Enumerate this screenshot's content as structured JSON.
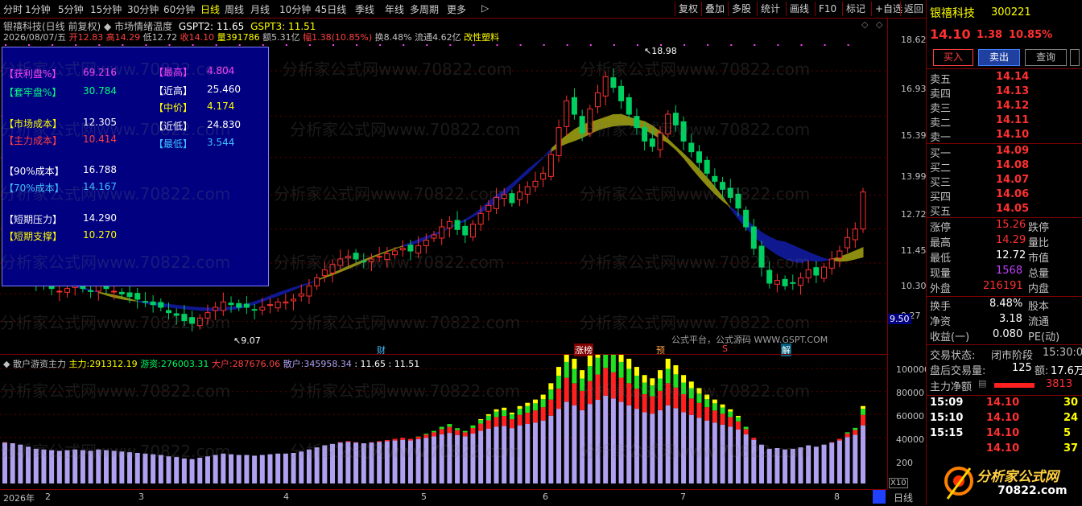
{
  "toolbar": {
    "periods": [
      "分时",
      "1分钟",
      "5分钟",
      "15分钟",
      "30分钟",
      "60分钟",
      "日线",
      "周线",
      "月线",
      "10分钟",
      "45日线",
      "季线",
      "年线",
      "多周期",
      "更多"
    ],
    "active_period": "日线",
    "more_arrow": "▷",
    "right_buttons": [
      "复权",
      "叠加",
      "多股",
      "统计",
      "画线",
      "F10",
      "标记",
      "+自选",
      "返回"
    ]
  },
  "chart_title": {
    "stock": "银禧科技(日线 前复权)",
    "indicator": "市场情绪温度",
    "gspt2": "GSPT2: 11.65",
    "gspt3": "GSPT3: 11.51"
  },
  "bar_info": {
    "date": "2026/08/07/五",
    "open_label": "开",
    "open": "12.83",
    "high_label": "高",
    "high": "14.29",
    "low_label": "低",
    "low": "12.72",
    "close_label": "收",
    "close": "14.10",
    "volume_label": "量",
    "volume": "391786",
    "amount_label": "额",
    "amount": "5.31亿",
    "change_label": "幅",
    "change": "1.38(10.85%)",
    "turnover_label": "换",
    "turnover": "8.48%",
    "float_label": "流通",
    "float": "4.62亿",
    "sector": "改性塑料"
  },
  "stats": {
    "profit_label": "【获利盘%】",
    "profit": "69.216",
    "trapped_label": "【套牢盘%】",
    "trapped": "30.784",
    "market_cost_label": "【市场成本】",
    "market_cost": "12.305",
    "main_cost_label": "【主力成本】",
    "main_cost": "10.414",
    "cost90_label": "【90%成本】",
    "cost90": "16.788",
    "cost70_label": "【70%成本】",
    "cost70": "14.167",
    "pressure_label": "【短期压力】",
    "pressure": "14.290",
    "support_label": "【短期支撑】",
    "support": "10.270",
    "highest_label": "【最高】",
    "highest": "4.804",
    "recent_high_label": "【近高】",
    "recent_high": "25.460",
    "mid_label": "【中价】",
    "mid": "4.174",
    "recent_low_label": "【近低】",
    "recent_low": "24.830",
    "lowest_label": "【最低】",
    "lowest": "3.544"
  },
  "price_axis": [
    "18.62",
    "16.93",
    "15.39",
    "13.99",
    "12.72",
    "11.45",
    "10.30",
    "9.27"
  ],
  "price_tag": "9.50",
  "chart_labels": {
    "high_mark": "18.98",
    "low_mark": "9.07",
    "event_cai": "财",
    "event_zhangbang": "涨榜",
    "event_yu": "预",
    "event_s": "S",
    "event_jie": "解",
    "platform_text": "公式平台，公式源码 WWW.GSPT.COM"
  },
  "watermark": "分析家公式网www.70822.com",
  "sub_chart": {
    "name": "散户游资主力",
    "main_label": "主力:",
    "main_value": "291312.19",
    "hot_label": "游资:",
    "hot_value": "276003.31",
    "big_label": "大户:",
    "big_value": "287676.06",
    "retail_label": "散户:",
    "retail_value": "345958.34",
    "v1": ": 11.65",
    "v2": ": 11.51"
  },
  "vol_axis": [
    "100000",
    "80000",
    "60000",
    "40000",
    "200"
  ],
  "vol_unit": "X10",
  "date_axis": [
    "2026年",
    "2",
    "3",
    "4",
    "5",
    "6",
    "7",
    "8"
  ],
  "date_tab": "日线",
  "quote": {
    "name": "银禧科技",
    "code": "300221",
    "price": "14.10",
    "change": "1.38",
    "change_pct": "10.85%",
    "buy_btn": "买入",
    "sell_btn": "卖出",
    "query_btn": "查询",
    "asks": [
      {
        "label": "卖五",
        "price": "14.14"
      },
      {
        "label": "卖四",
        "price": "14.13"
      },
      {
        "label": "卖三",
        "price": "14.12"
      },
      {
        "label": "卖二",
        "price": "14.11"
      },
      {
        "label": "卖一",
        "price": "14.10"
      }
    ],
    "bids": [
      {
        "label": "买一",
        "price": "14.09"
      },
      {
        "label": "买二",
        "price": "14.08"
      },
      {
        "label": "买三",
        "price": "14.07"
      },
      {
        "label": "买四",
        "price": "14.06"
      },
      {
        "label": "买五",
        "price": "14.05"
      }
    ],
    "limit_up_label": "涨停",
    "limit_up": "15.26",
    "limit_down_label": "跌停",
    "high_label": "最高",
    "high": "14.29",
    "vol_ratio_label": "量比",
    "low_label": "最低",
    "low": "12.72",
    "mkt_value_label": "市值",
    "cur_vol_label": "现量",
    "cur_vol": "1568",
    "total_vol_label": "总量",
    "outer_label": "外盘",
    "outer": "216191",
    "inner_label": "内盘",
    "turnover_label": "换手",
    "turnover": "8.48%",
    "shares_label": "股本",
    "nav_label": "净资",
    "nav": "3.18",
    "float_label": "流通",
    "eps_label": "收益(一)",
    "eps": "0.080",
    "pe_label": "PE(动)",
    "trade_status_label": "交易状态:",
    "trade_status": "闭市阶段",
    "trade_time": "15:30:0",
    "after_vol_label": "盘后交易量:",
    "after_vol": "125",
    "after_amt_label": "额:",
    "after_amt": "17.6万",
    "net_label": "主力净额",
    "net_value": "3813",
    "ticks": [
      {
        "time": "15:09",
        "price": "14.10",
        "vol": "30"
      },
      {
        "time": "15:10",
        "price": "14.10",
        "vol": "24"
      },
      {
        "time": "15:15",
        "price": "14.10",
        "vol": "5"
      },
      {
        "time": "",
        "price": "14.10",
        "vol": "37"
      }
    ],
    "logo_text": "分析家公式网",
    "logo_url": "70822.com"
  },
  "colors": {
    "up": "#ff3030",
    "down": "#00d060",
    "bg_panel": "#000080",
    "yellow": "#ffff00",
    "band_olive": "#8c8c10",
    "band_blue": "#101890",
    "purple_bar": "#b0a0f0",
    "magenta": "#ff40ff"
  },
  "chart_data": {
    "type": "candlestick",
    "closes": [
      11.6,
      11.5,
      11.3,
      11.0,
      10.7,
      10.6,
      10.5,
      10.4,
      10.5,
      10.6,
      10.5,
      10.4,
      10.6,
      10.5,
      10.4,
      10.3,
      10.2,
      10.1,
      10.0,
      9.9,
      9.8,
      9.6,
      9.5,
      9.3,
      9.2,
      9.4,
      9.6,
      9.8,
      10.0,
      9.9,
      9.8,
      9.8,
      9.7,
      9.8,
      9.9,
      10.0,
      10.0,
      10.1,
      10.3,
      10.6,
      10.9,
      11.2,
      11.4,
      11.6,
      11.7,
      11.6,
      11.5,
      11.6,
      11.7,
      11.8,
      11.9,
      12.0,
      11.9,
      12.1,
      12.3,
      12.5,
      12.8,
      13.0,
      12.7,
      12.5,
      12.9,
      13.3,
      13.6,
      13.9,
      14.0,
      13.7,
      14.1,
      14.3,
      14.5,
      14.8,
      15.5,
      16.5,
      17.5,
      17.0,
      16.3,
      17.2,
      17.8,
      18.4,
      18.0,
      17.5,
      17.0,
      16.5,
      16.0,
      15.8,
      16.3,
      17.0,
      16.6,
      16.0,
      15.6,
      15.2,
      14.8,
      14.5,
      14.2,
      13.9,
      13.5,
      12.8,
      12.0,
      11.3,
      10.7,
      10.8,
      10.6,
      10.7,
      10.9,
      11.2,
      11.0,
      11.3,
      11.6,
      11.9,
      12.4,
      12.72,
      14.1
    ]
  }
}
